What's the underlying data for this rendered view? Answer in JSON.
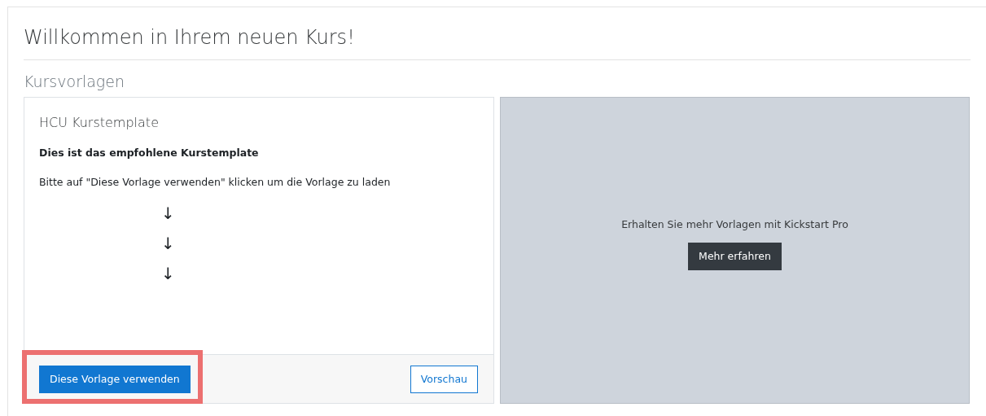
{
  "page": {
    "title": "Willkommen in Ihrem neuen Kurs!"
  },
  "section": {
    "title": "Kursvorlagen"
  },
  "template_card": {
    "title": "HCU Kurstemplate",
    "subtitle": "Dies ist das empfohlene Kurstemplate",
    "description": "Bitte auf \"Diese Vorlage verwenden\" klicken um die Vorlage zu laden",
    "arrows": [
      "↓",
      "↓",
      "↓"
    ],
    "buttons": [
      {
        "label": "Diese Vorlage verwenden",
        "kind": "primary",
        "highlighted": true
      },
      {
        "label": "Vorschau",
        "kind": "outline",
        "highlighted": false
      }
    ]
  },
  "promo": {
    "text": "Erhalten Sie mehr Vorlagen mit Kickstart Pro",
    "button": "Mehr erfahren"
  }
}
